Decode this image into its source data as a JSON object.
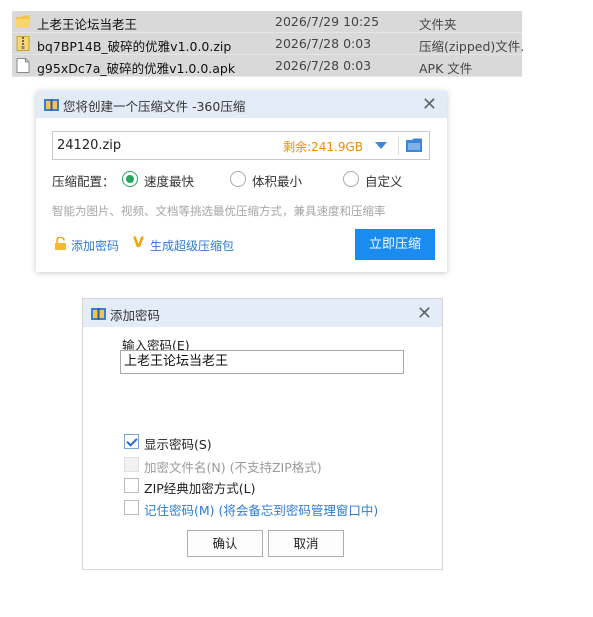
{
  "files": [
    {
      "name": "上老王论坛当老王",
      "date": "2026/7/29 10:25",
      "type": "文件夹",
      "icon": "folder-icon"
    },
    {
      "name": "bq7BP14B_破碎的优雅v1.0.0.zip",
      "date": "2026/7/28 0:03",
      "type": "压缩(zipped)文件...",
      "icon": "zip-file-icon"
    },
    {
      "name": "g95xDc7a_破碎的优雅v1.0.0.apk",
      "date": "2026/7/28 0:03",
      "type": "APK 文件",
      "icon": "file-icon"
    }
  ],
  "compress_dialog": {
    "title": "您将创建一个压缩文件 -360压缩",
    "filename": "24120.zip",
    "free_space": "剩余:241.9GB",
    "config_label": "压缩配置：",
    "options": [
      "速度最快",
      "体积最小",
      "自定义"
    ],
    "selected_option": "速度最快",
    "hint": "智能为图片、视频、文档等挑选最优压缩方式，兼具速度和压缩率",
    "add_password": "添加密码",
    "super_pack": "生成超级压缩包",
    "compress_now": "立即压缩",
    "accent_color": "#1a8cf0"
  },
  "password_dialog": {
    "title": "添加密码",
    "input_label": "输入密码(E)",
    "password_value": "上老王论坛当老王",
    "show_password": "显示密码(S)",
    "show_password_checked": true,
    "encrypt_filename": "加密文件名(N) (不支持ZIP格式)",
    "encrypt_filename_enabled": false,
    "zip_classic": "ZIP经典加密方式(L)",
    "remember_password": "记住密码(M) (将会备忘到密码管理窗口中)",
    "ok": "确认",
    "cancel": "取消"
  }
}
